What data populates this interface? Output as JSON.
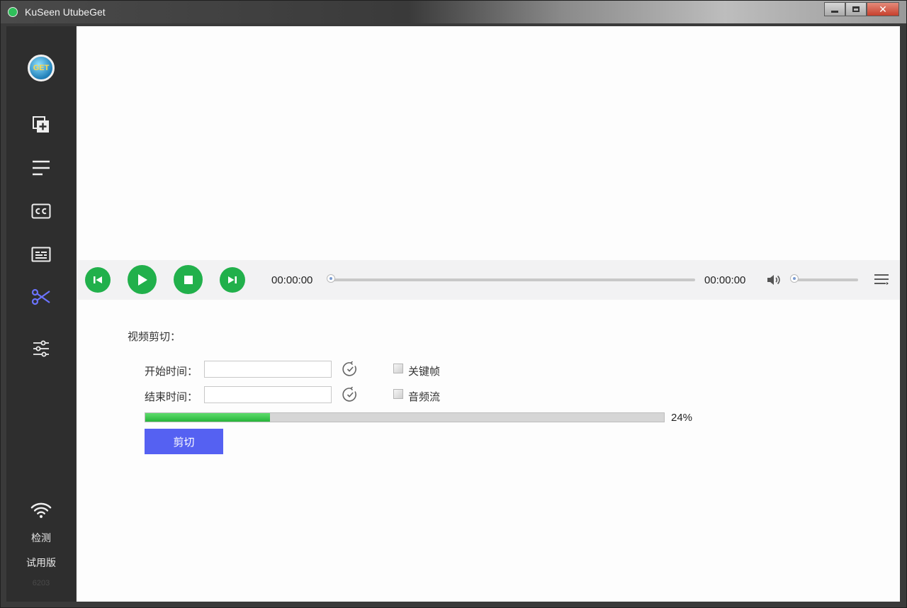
{
  "window": {
    "title": "KuSeen UtubeGet"
  },
  "sidebar": {
    "logo_text": "GET",
    "check_label": "检测",
    "trial_label": "试用版",
    "version": "6203"
  },
  "player": {
    "current_time": "00:00:00",
    "total_time": "00:00:00",
    "progress_fraction": 0,
    "volume_fraction": 0
  },
  "cut": {
    "section_title": "视频剪切：",
    "start_label": "开始时间：",
    "end_label": "结束时间：",
    "start_value": "",
    "end_value": "",
    "keyframe_label": "关键帧",
    "audio_label": "音频流",
    "progress_percent": 24,
    "progress_text": "24%",
    "button_label": "剪切"
  },
  "colors": {
    "accent": "#5561f2",
    "green": "#21b04b",
    "active_icon": "#6b73ff"
  }
}
